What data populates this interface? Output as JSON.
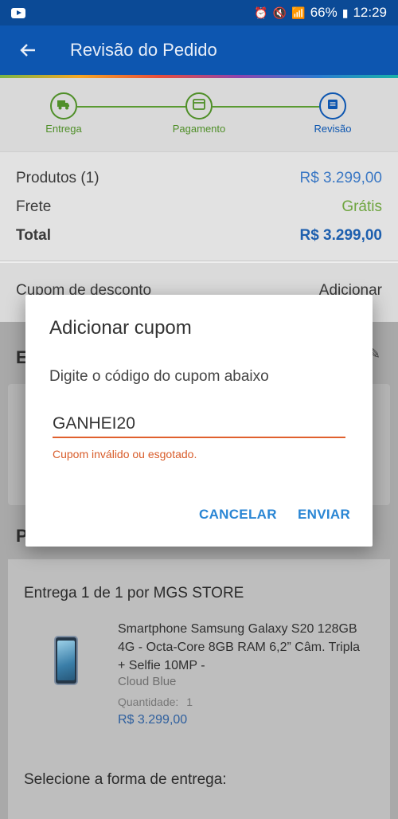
{
  "status_bar": {
    "battery": "66%",
    "time": "12:29"
  },
  "app_bar": {
    "title": "Revisão do Pedido",
    "back_icon": "arrow-left-icon"
  },
  "stepper": {
    "steps": [
      {
        "label": "Entrega",
        "icon": "truck-icon",
        "state": "done"
      },
      {
        "label": "Pagamento",
        "icon": "card-icon",
        "state": "done"
      },
      {
        "label": "Revisão",
        "icon": "document-icon",
        "state": "current"
      }
    ]
  },
  "summary": {
    "products_label": "Produtos (1)",
    "products_value": "R$ 3.299,00",
    "shipping_label": "Frete",
    "shipping_value": "Grátis",
    "total_label": "Total",
    "total_value": "R$ 3.299,00"
  },
  "coupon": {
    "label": "Cupom de desconto",
    "action": "Adicionar"
  },
  "background_section": {
    "heading_initial": "E",
    "section_p_initial": "P"
  },
  "delivery": {
    "title": "Entrega 1 de 1 por MGS STORE",
    "product_name": "Smartphone Samsung Galaxy S20 128GB 4G - Octa-Core 8GB RAM 6,2” Câm. Tripla + Selfie 10MP -",
    "product_color": "Cloud Blue",
    "quantity_label": "Quantidade:",
    "quantity_value": "1",
    "product_price": "R$ 3.299,00",
    "shipping_method_title": "Selecione a forma de entrega:"
  },
  "dialog": {
    "title": "Adicionar cupom",
    "message": "Digite o código do cupom abaixo",
    "input_value": "GANHEI20",
    "error": "Cupom inválido ou esgotado.",
    "cancel_label": "CANCELAR",
    "submit_label": "ENVIAR"
  },
  "colors": {
    "primary": "#0d56b0",
    "success": "#4f8f28",
    "error": "#d85c2a",
    "accent": "#2a86d4"
  }
}
